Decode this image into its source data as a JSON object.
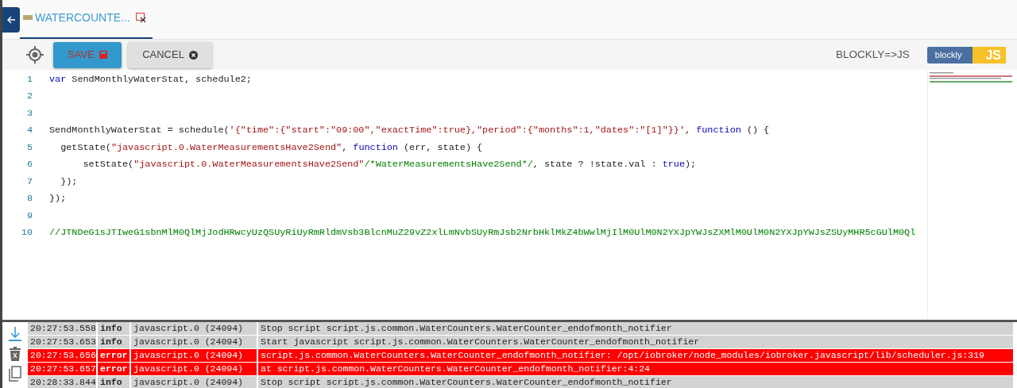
{
  "tabs": [
    {
      "label": "WATERCOUNTE...",
      "selected": true
    }
  ],
  "toolbar": {
    "save": "SAVE",
    "cancel": "CANCEL",
    "mode_label": "BLOCKLY=>JS",
    "blockly_badge": "blockly",
    "js_badge": "JS"
  },
  "code_lines": [
    {
      "number": "1",
      "segments": [
        {
          "kind": "keyword",
          "text": "var"
        },
        {
          "kind": "plain",
          "text": " SendMonthlyWaterStat, schedule2;"
        }
      ]
    },
    {
      "number": "2"
    },
    {
      "number": "3"
    },
    {
      "number": "4",
      "segments": [
        {
          "kind": "plain",
          "text": "SendMonthlyWaterStat = schedule("
        },
        {
          "kind": "string",
          "text": "'{\"time\":{\"start\":\"09:00\",\"exactTime\":true},\"period\":{\"months\":1,\"dates\":\"[1]\"}}'"
        },
        {
          "kind": "plain",
          "text": ", "
        },
        {
          "kind": "keyword",
          "text": "function"
        },
        {
          "kind": "plain",
          "text": " () {"
        }
      ]
    },
    {
      "number": "5",
      "segments": [
        {
          "kind": "plain",
          "text": "  getState("
        },
        {
          "kind": "string",
          "text": "\"javascript.0.WaterMeasurementsHave2Send\""
        },
        {
          "kind": "plain",
          "text": ", "
        },
        {
          "kind": "keyword",
          "text": "function"
        },
        {
          "kind": "plain",
          "text": " (err, state) {"
        }
      ]
    },
    {
      "number": "6",
      "segments": [
        {
          "kind": "plain",
          "text": "      setState("
        },
        {
          "kind": "string",
          "text": "\"javascript.0.WaterMeasurementsHave2Send\""
        },
        {
          "kind": "comment",
          "text": "/*WaterMeasurementsHave2Send*/"
        },
        {
          "kind": "plain",
          "text": ", state ? !state.val : "
        },
        {
          "kind": "keyword",
          "text": "true"
        },
        {
          "kind": "plain",
          "text": ");"
        }
      ]
    },
    {
      "number": "7",
      "segments": [
        {
          "kind": "plain",
          "text": "  });"
        }
      ]
    },
    {
      "number": "8",
      "segments": [
        {
          "kind": "plain",
          "text": "});"
        }
      ]
    },
    {
      "number": "9"
    },
    {
      "number": "10",
      "segments": [
        {
          "kind": "comment",
          "text": "//JTNDeG1sJTIweG1sbnMlM0QlMjJodHRwcyUzQSUyRiUyRmRldmVsb3BlcnMuZ29vZ2xlLmNvbSUyRmJsb2NrbHklMkZ4bWwlMjIlM0UlM0N2YXJpYWJsZXMlM0UlM0N2YXJpYWJsZSUyMHR5cGUlM0Ql"
        }
      ]
    }
  ],
  "log": [
    {
      "time": "20:27:53.558",
      "level": "info",
      "source": "javascript.0 (24094)",
      "message": "Stop script script.js.common.WaterCounters.WaterCounter_endofmonth_notifier"
    },
    {
      "time": "20:27:53.653",
      "level": "info",
      "source": "javascript.0 (24094)",
      "message": "Start javascript script.js.common.WaterCounters.WaterCounter_endofmonth_notifier"
    },
    {
      "time": "20:27:53.656",
      "level": "error",
      "source": "javascript.0 (24094)",
      "message": "script.js.common.WaterCounters.WaterCounter_endofmonth_notifier: /opt/iobroker/node_modules/iobroker.javascript/lib/scheduler.js:319"
    },
    {
      "time": "20:27:53.657",
      "level": "error",
      "source": "javascript.0 (24094)",
      "message": "at script.js.common.WaterCounters.WaterCounter_endofmonth_notifier:4:24"
    },
    {
      "time": "20:28:33.844",
      "level": "info",
      "source": "javascript.0 (24094)",
      "message": "Stop script script.js.common.WaterCounters.WaterCounter_endofmonth_notifier"
    }
  ]
}
